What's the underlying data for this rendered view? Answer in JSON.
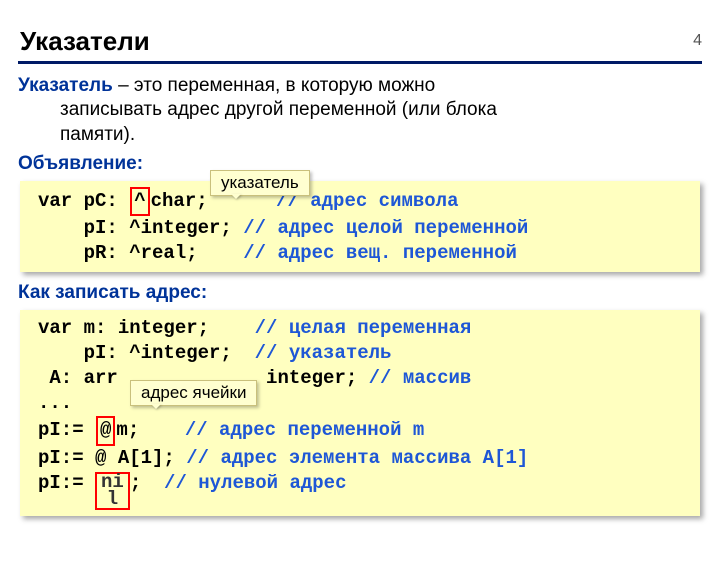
{
  "page_number": "4",
  "title": "Указатели",
  "definition": {
    "term": "Указатель",
    "line1_tail": " – это переменная, в которую можно",
    "line2": "записывать адрес другой переменной (или блока",
    "line3": "памяти)."
  },
  "declaration_heading": "Объявление:",
  "callout_pointer": "указатель",
  "code1": {
    "l1a": "var pC: ",
    "l1caret": "^",
    "l1b": "char;      ",
    "l1c": "// адрес символа",
    "l2a": "    pI: ^integer; ",
    "l2c": "// адрес целой переменной",
    "l3a": "    pR: ^real;    ",
    "l3c": "// адрес вещ. переменной"
  },
  "write_heading": "Как записать адрес:",
  "callout_cell": "адрес ячейки",
  "code2": {
    "l1a": "var m: integer;    ",
    "l1c": "// целая переменная",
    "l2a": "    pI: ^integer;  ",
    "l2c": "// указатель",
    "l3a": " A: arr             integer; ",
    "l3c": "// массив",
    "l4": "...",
    "l5a": "pI:= ",
    "l5at": "@",
    "l5b": "m;    ",
    "l5c": "// адрес переменной m",
    "l6a": "pI:= @ A[1]; ",
    "l6c": "// адрес элемента массива A[1]",
    "l7a": "pI:= ",
    "l7nil1": "ni",
    "l7nil2": "l",
    "l7b": ";  ",
    "l7c": "// нулевой адрес"
  }
}
